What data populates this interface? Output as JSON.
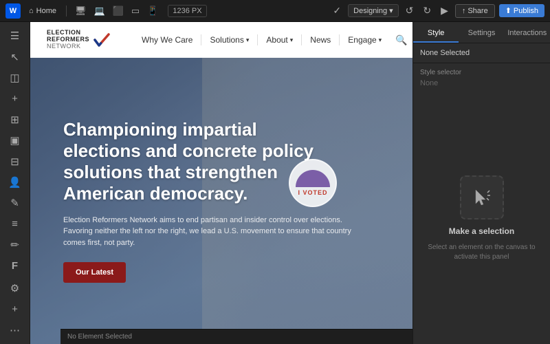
{
  "topbar": {
    "wix_label": "W",
    "home_label": "Home",
    "px_display": "1236 PX",
    "designing_label": "Designing",
    "share_label": "Share",
    "publish_label": "Publish",
    "device_icons": [
      "🖥",
      "💻",
      "📱",
      "📱",
      "⬛"
    ],
    "zoom_icon": "⊕"
  },
  "left_tools": {
    "tools": [
      {
        "name": "menu-tool",
        "icon": "☰"
      },
      {
        "name": "pointer-tool",
        "icon": "↖"
      },
      {
        "name": "layers-tool",
        "icon": "◫"
      },
      {
        "name": "add-tool",
        "icon": "+"
      },
      {
        "name": "components-tool",
        "icon": "⊞"
      },
      {
        "name": "media-tool",
        "icon": "▣"
      },
      {
        "name": "apps-tool",
        "icon": "⊟"
      },
      {
        "name": "contact-tool",
        "icon": "👤"
      },
      {
        "name": "blog-tool",
        "icon": "✎"
      },
      {
        "name": "data-tool",
        "icon": "⊗"
      },
      {
        "name": "paint-tool",
        "icon": "✏"
      },
      {
        "name": "f-tool",
        "icon": "f"
      }
    ],
    "bottom_tools": [
      {
        "name": "settings-tool",
        "icon": "⚙"
      },
      {
        "name": "add-bottom-tool",
        "icon": "+"
      },
      {
        "name": "more-tool",
        "icon": "⋯"
      }
    ]
  },
  "site_nav": {
    "logo": {
      "election": "ELECTION",
      "reformers": "REFORMERS",
      "network": "NETWORK"
    },
    "links": [
      {
        "label": "Why We Care",
        "has_dropdown": false
      },
      {
        "label": "Solutions",
        "has_dropdown": true
      },
      {
        "label": "About",
        "has_dropdown": true
      },
      {
        "label": "News",
        "has_dropdown": false
      },
      {
        "label": "Engage",
        "has_dropdown": true
      }
    ]
  },
  "hero": {
    "headline": "Championing impartial elections and concrete policy solutions that strengthen American democracy.",
    "subtext": "Election Reformers Network aims to end partisan and insider control over elections. Favoring neither the left nor the right, we lead a U.S. movement to ensure that country comes first, not party.",
    "cta_label": "Our Latest",
    "i_voted_text": "I VOTED"
  },
  "right_panel": {
    "tabs": [
      {
        "label": "Style",
        "active": true
      },
      {
        "label": "Settings",
        "active": false
      },
      {
        "label": "Interactions",
        "active": false
      }
    ],
    "none_selected": "None Selected",
    "style_selector_label": "Style selector",
    "none_value": "None",
    "make_selection_title": "Make a selection",
    "make_selection_desc": "Select an element on the canvas to activate this panel"
  },
  "status_bar": {
    "text": "No Element Selected"
  }
}
